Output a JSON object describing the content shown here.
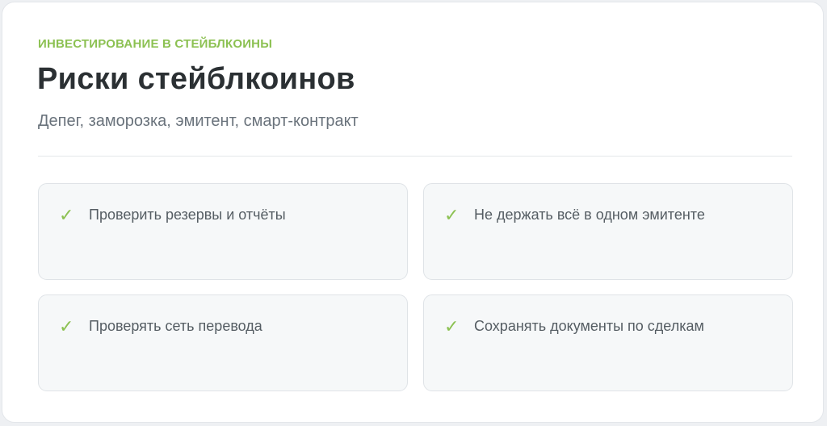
{
  "header": {
    "eyebrow": "ИНВЕСТИРОВАНИЕ В СТЕЙБЛКОИНЫ",
    "title": "Риски стейблкоинов",
    "subtitle": "Депег, заморозка, эмитент, смарт-контракт"
  },
  "checklist": {
    "icon": "check-icon",
    "check_glyph": "✓",
    "items": [
      {
        "label": "Проверить резервы и отчёты"
      },
      {
        "label": "Не держать всё в одном эмитенте"
      },
      {
        "label": "Проверять сеть перевода"
      },
      {
        "label": "Сохранять документы по сделкам"
      }
    ]
  },
  "colors": {
    "accent": "#8cc152",
    "title": "#2b3033",
    "muted": "#6a737c",
    "card_bg": "#f6f8f9",
    "border": "#dfe3e7"
  }
}
